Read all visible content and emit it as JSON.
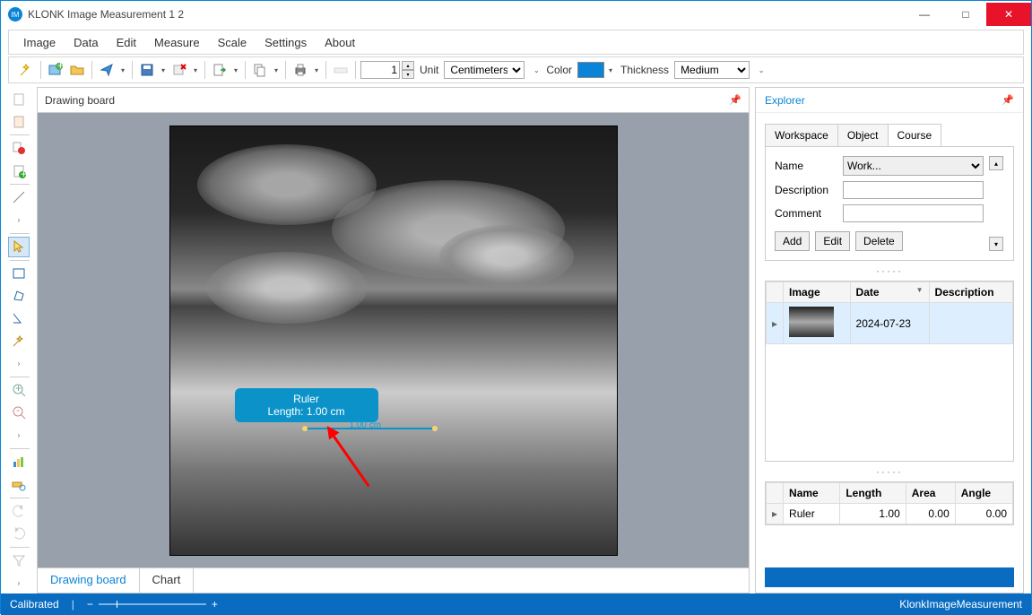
{
  "window": {
    "title": "KLONK Image Measurement 1 2"
  },
  "menu": {
    "items": [
      "Image",
      "Data",
      "Edit",
      "Measure",
      "Scale",
      "Settings",
      "About"
    ]
  },
  "toolbar": {
    "number_value": "1",
    "unit_label": "Unit",
    "unit_value": "Centimeters",
    "color_label": "Color",
    "thickness_label": "Thickness",
    "thickness_value": "Medium"
  },
  "drawing": {
    "title": "Drawing board",
    "tabs": {
      "board": "Drawing board",
      "chart": "Chart"
    },
    "ruler_tooltip_title": "Ruler",
    "ruler_tooltip_length": "Length: 1.00 cm",
    "ruler_overlay_label": "1.00 cm"
  },
  "explorer": {
    "title": "Explorer",
    "tabs": {
      "workspace": "Workspace",
      "object": "Object",
      "course": "Course"
    },
    "form": {
      "name_label": "Name",
      "name_value": "Work...",
      "desc_label": "Description",
      "desc_value": "",
      "comment_label": "Comment",
      "comment_value": "",
      "add": "Add",
      "edit": "Edit",
      "delete": "Delete"
    },
    "imagegrid": {
      "headers": {
        "image": "Image",
        "date": "Date",
        "desc": "Description"
      },
      "row": {
        "date": "2024-07-23",
        "desc": ""
      }
    },
    "measuregrid": {
      "headers": {
        "name": "Name",
        "length": "Length",
        "area": "Area",
        "angle": "Angle"
      },
      "row": {
        "name": "Ruler",
        "length": "1.00",
        "area": "0.00",
        "angle": "0.00"
      }
    }
  },
  "status": {
    "calibrated": "Calibrated",
    "brand": "KlonkImageMeasurement"
  }
}
